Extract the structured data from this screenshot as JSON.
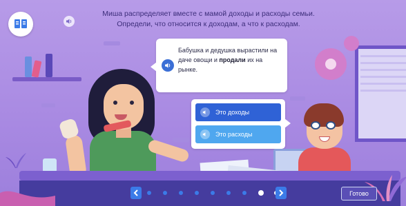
{
  "instruction": {
    "line1": "Миша распределяет вместе с мамой доходы и расходы семьи.",
    "line2": "Определи, что относится к доходам, а что к расходам."
  },
  "icons": {
    "textbook": "book-icon",
    "speaker": "speaker-icon",
    "prev": "chevron-left-icon",
    "next": "chevron-right-icon"
  },
  "bubble": {
    "part1": "Бабушка и дедушка вырастили на даче овощи и ",
    "bold": "продали",
    "part2": " их на рынке."
  },
  "options": [
    {
      "label": "Это доходы",
      "selected": true
    },
    {
      "label": "Это расходы",
      "selected": false
    }
  ],
  "navigation": {
    "total_pages": 9,
    "current_page": 8,
    "done_label": "Готово"
  },
  "colors": {
    "background": "#b79be8",
    "option_primary": "#2f62d6",
    "option_secondary": "#4fa7ef",
    "nav_accent": "#3b7be8"
  }
}
